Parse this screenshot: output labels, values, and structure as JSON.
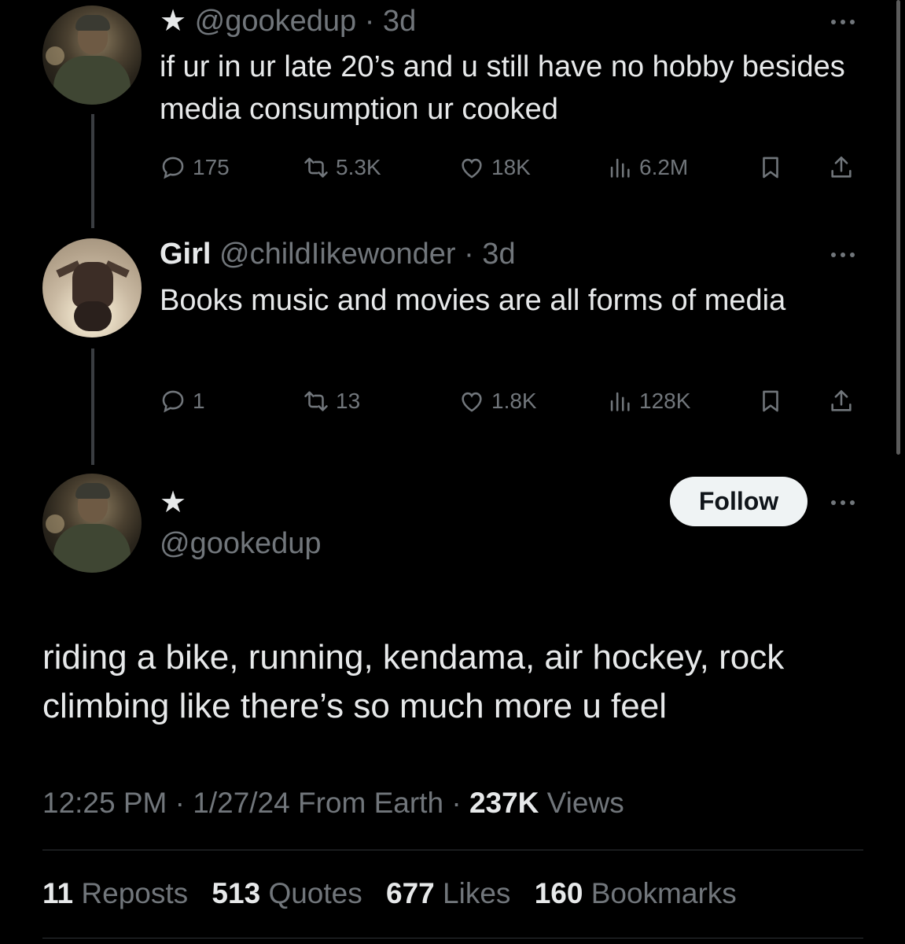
{
  "thread": [
    {
      "star": "★",
      "name": "",
      "handle": "@gookedup",
      "time": "· 3d",
      "text": "if ur in ur late 20’s and u still have no hobby besides media consumption ur cooked",
      "replies": "175",
      "reposts": "5.3K",
      "likes": "18K",
      "views": "6.2M"
    },
    {
      "name": "Girl",
      "handle": "@childIikewonder",
      "time": "· 3d",
      "text": "Books music and movies are all forms of media",
      "replies": "1",
      "reposts": "13",
      "likes": "1.8K",
      "views": "128K"
    }
  ],
  "main_tweet": {
    "star": "★",
    "handle": "@gookedup",
    "follow_label": "Follow",
    "text": "riding a bike, running, kendama, air hockey, rock climbing like there’s so much more u feel",
    "time": "12:25 PM",
    "date": "1/27/24",
    "source": "From Earth",
    "views_count": "237K",
    "views_label": "Views",
    "sep": "·"
  },
  "stats": {
    "reposts_count": "11",
    "reposts_label": "Reposts",
    "quotes_count": "513",
    "quotes_label": "Quotes",
    "likes_count": "677",
    "likes_label": "Likes",
    "bookmarks_count": "160",
    "bookmarks_label": "Bookmarks"
  },
  "colors": {
    "background": "#000000",
    "text_primary": "#e7e9ea",
    "text_secondary": "#71767b",
    "divider": "#2f3336",
    "follow_button_bg": "#eff3f4"
  },
  "icons": [
    "reply-icon",
    "repost-icon",
    "like-icon",
    "views-icon",
    "bookmark-icon",
    "share-icon",
    "more-icon",
    "star-icon"
  ]
}
